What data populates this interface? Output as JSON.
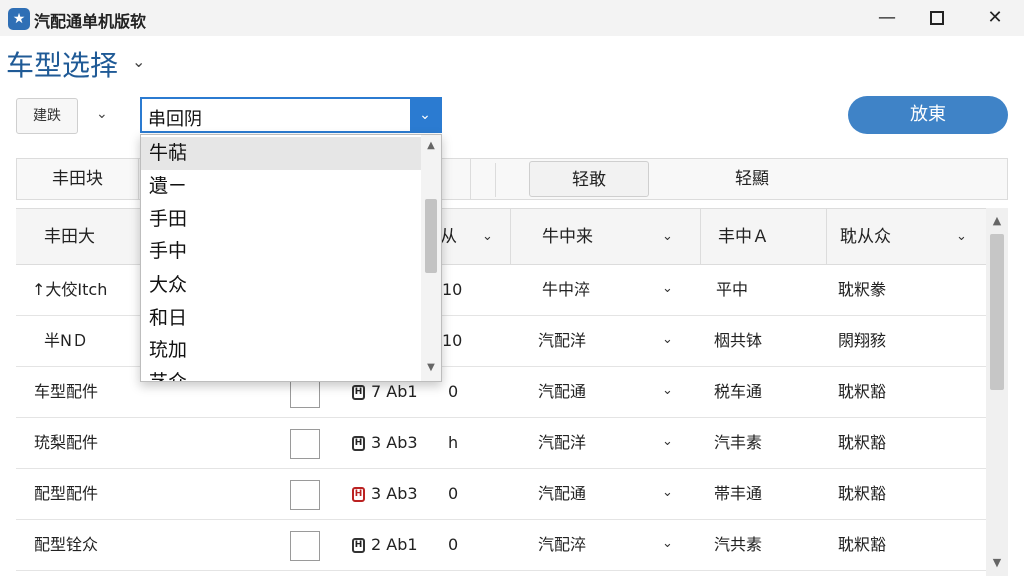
{
  "window": {
    "title": "汽配通单机版软",
    "icon": "app-logo-icon",
    "controls": {
      "minimize": "—",
      "close": "✕"
    }
  },
  "header": {
    "title": "车型选择",
    "chevron": "⌄"
  },
  "filters": {
    "small_button_label": "建跌",
    "small_chevron": "⌄",
    "combo_value": "串回阴",
    "combo_arrow": "⌄",
    "primary_button_label": "放東"
  },
  "toolbar": {
    "items": [
      "丰田块",
      "",
      "轻敢",
      "轻顯"
    ]
  },
  "dropdown": {
    "items": [
      "牛萜",
      "遺ㄧ",
      "手田",
      "手中",
      "大众",
      "和日",
      "珫加",
      "艺众"
    ],
    "selected_index": 0
  },
  "table": {
    "headers": [
      "丰田大",
      "",
      "从",
      "牛中来",
      "丰中Ａ",
      "耽从众"
    ],
    "rows": [
      {
        "name": "↑大佼Itch",
        "checkbox": false,
        "code": "",
        "code_icon_color": "",
        "value": "10",
        "supplier": "牛中淬",
        "location": "平中",
        "status": "耽粎豢"
      },
      {
        "name": "半NＤ",
        "checkbox": false,
        "code": "",
        "code_icon_color": "",
        "value": "10",
        "supplier": "汽配洋",
        "location": "栶共钵",
        "status": "閖翔豥"
      },
      {
        "name": "车型配件",
        "checkbox": false,
        "code": "7 Ab1",
        "code_icon_color": "#333333",
        "value": "0",
        "supplier": "汽配通",
        "location": "税车通",
        "status": "耽粎豁"
      },
      {
        "name": "珫梨配件",
        "checkbox": false,
        "code": "3 Ab3",
        "code_icon_color": "#333333",
        "value": "h",
        "supplier": "汽配洋",
        "location": "汽丰素",
        "status": "耽粎豁"
      },
      {
        "name": "配型配件",
        "checkbox": false,
        "code": "3 Ab3",
        "code_icon_color": "#b22222",
        "value": "0",
        "supplier": "汽配通",
        "location": "帯丰通",
        "status": "耽粎豁"
      },
      {
        "name": "配型铨众",
        "checkbox": false,
        "code": "2 Ab1",
        "code_icon_color": "#333333",
        "value": "0",
        "supplier": "汽配淬",
        "location": "汽共素",
        "status": "耽粎豁"
      }
    ]
  },
  "colors": {
    "accent": "#2b7bd1",
    "primary_button": "#3f83c7",
    "title_blue": "#1f5a96"
  }
}
